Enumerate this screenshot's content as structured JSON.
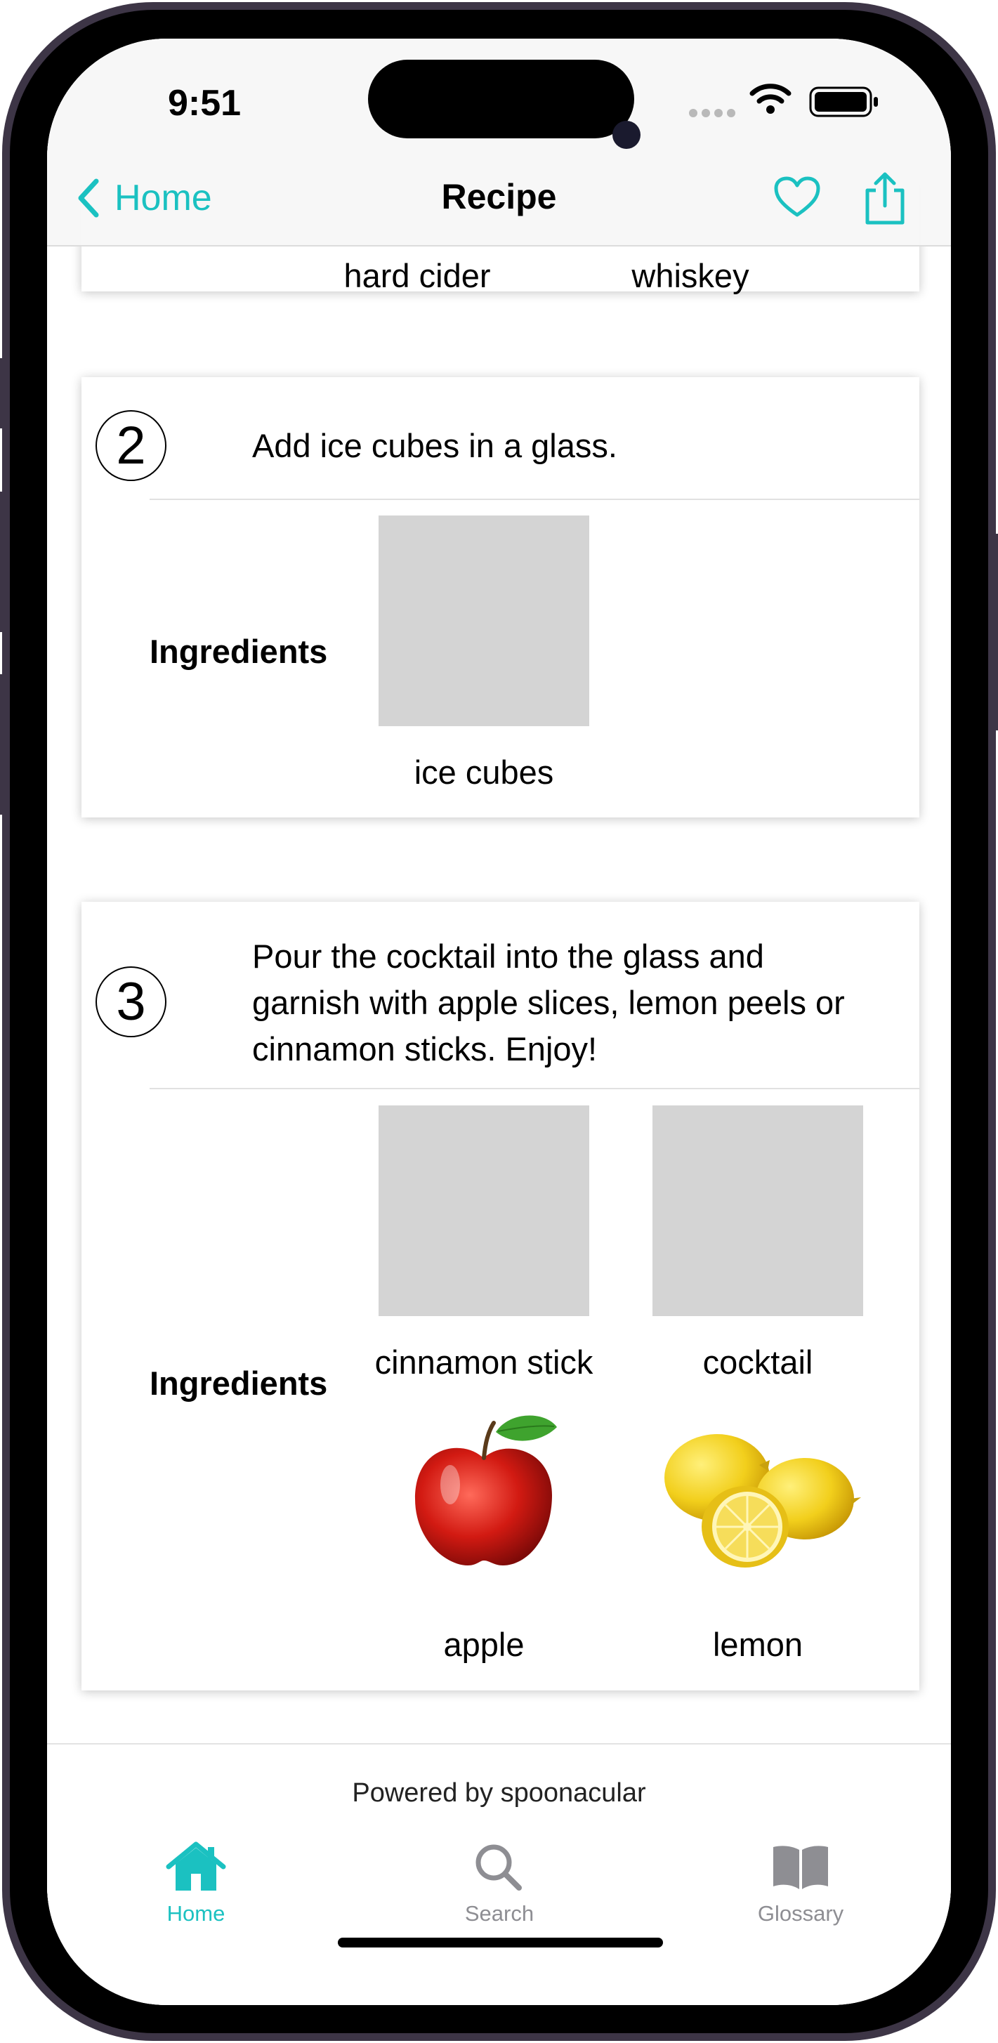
{
  "status": {
    "time": "9:51"
  },
  "nav": {
    "back_label": "Home",
    "title": "Recipe"
  },
  "partial_card": {
    "ingredients": [
      "hard cider",
      "whiskey"
    ]
  },
  "steps": [
    {
      "number": "2",
      "instruction_lines": [
        "Add ice cubes in a glass."
      ],
      "ingredients_label": "Ingredients",
      "ingredients": [
        "ice cubes"
      ]
    },
    {
      "number": "3",
      "instruction_lines": [
        "Pour the cocktail into the glass and",
        "garnish with apple slices, lemon peels or",
        "cinnamon sticks. Enjoy!"
      ],
      "ingredients_label": "Ingredients",
      "ingredients": [
        "cinnamon stick",
        "cocktail",
        "apple",
        "lemon"
      ]
    }
  ],
  "footer": {
    "powered_by": "Powered by spoonacular"
  },
  "tabs": [
    {
      "label": "Home",
      "icon": "house-icon",
      "active": true
    },
    {
      "label": "Search",
      "icon": "magnifier-icon",
      "active": false
    },
    {
      "label": "Glossary",
      "icon": "book-icon",
      "active": false
    }
  ],
  "colors": {
    "accent": "#1bc1c1",
    "inactive": "#8e8e93",
    "placeholder": "#d4d4d4"
  }
}
